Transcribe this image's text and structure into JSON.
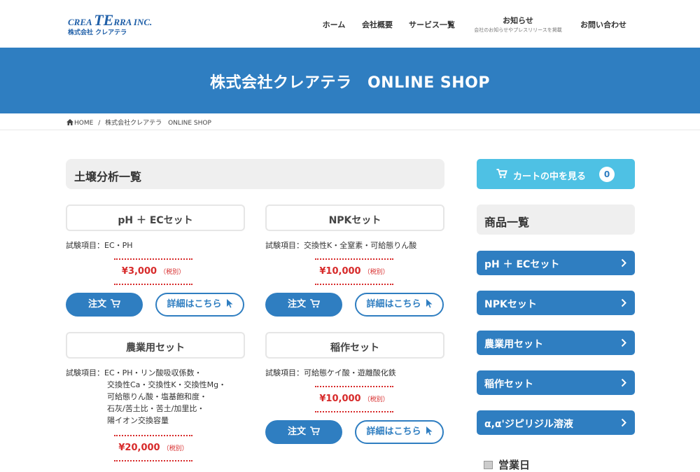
{
  "logo": {
    "line1_a": "CREA",
    "line1_b": "TE",
    "line1_c": "RRA INC.",
    "line2": "株式会社 クレアテラ"
  },
  "nav": [
    {
      "label": "ホーム"
    },
    {
      "label": "会社概要"
    },
    {
      "label": "サービス一覧"
    },
    {
      "label": "お知らせ",
      "sub": "会社のお知らせやプレスリリースを掲載"
    },
    {
      "label": "お問い合わせ"
    }
  ],
  "banner": {
    "title": "株式会社クレアテラ　ONLINE SHOP"
  },
  "breadcrumb": {
    "home": "HOME",
    "sep": "/",
    "current": "株式会社クレアテラ　ONLINE SHOP"
  },
  "section": {
    "title": "土壌分析一覧"
  },
  "products": [
    {
      "name": "pH ＋ ECセット",
      "items_prefix": "試験項目：",
      "items": [
        "EC・PH"
      ],
      "price": "¥3,000",
      "tax": "（税別）",
      "order": "注文",
      "detail": "詳細はこちら"
    },
    {
      "name": "NPKセット",
      "items_prefix": "試験項目：",
      "items": [
        "交換性K・全窒素・可給態りん酸"
      ],
      "price": "¥10,000",
      "tax": "（税別）",
      "order": "注文",
      "detail": "詳細はこちら"
    },
    {
      "name": "農業用セット",
      "items_prefix": "試験項目：",
      "items": [
        "EC・PH・リン酸吸収係数・",
        "交換性Ca・交換性K・交換性Mg・",
        "可給態りん酸・塩基飽和度・",
        "石灰/苦土比・苦土/加里比・",
        "陽イオン交換容量"
      ],
      "price": "¥20,000",
      "tax": "（税別）"
    },
    {
      "name": "稲作セット",
      "items_prefix": "試験項目：",
      "items": [
        "可給態ケイ酸・遊離酸化鉄"
      ],
      "price": "¥10,000",
      "tax": "（税別）",
      "order": "注文",
      "detail": "詳細はこちら"
    }
  ],
  "sidebar": {
    "cart": {
      "label": "カートの中を見る",
      "count": "0"
    },
    "list_title": "商品一覧",
    "items": [
      "pH ＋ ECセット",
      "NPKセット",
      "農業用セット",
      "稲作セット",
      "α,α'ジピリジル溶液"
    ],
    "business_title": "営業日"
  },
  "colors": {
    "primary": "#2f7ec1",
    "cart": "#4ec1e4",
    "price": "#d72a2a"
  }
}
